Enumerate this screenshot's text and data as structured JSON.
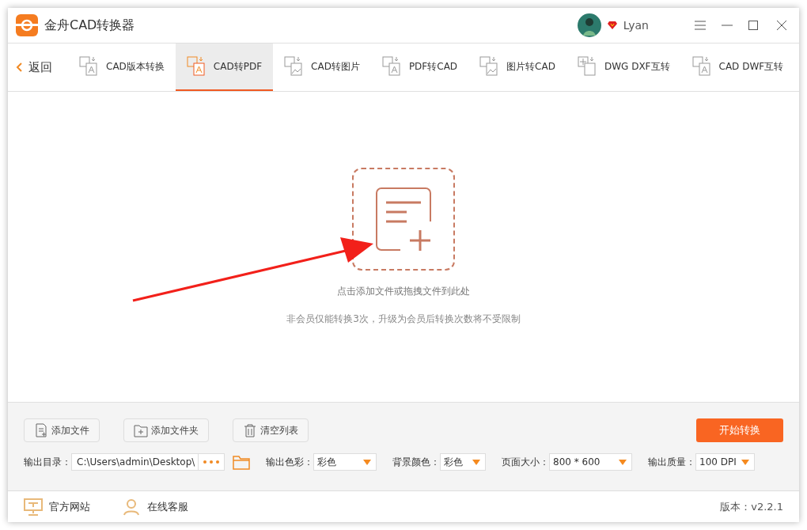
{
  "window": {
    "title": "金舟CAD转换器",
    "user": "Lyan"
  },
  "toolbar": {
    "back": "返回",
    "tabs": [
      {
        "label": "CAD版本转换",
        "selected": false,
        "kind": "a"
      },
      {
        "label": "CAD转PDF",
        "selected": true,
        "kind": "pdf"
      },
      {
        "label": "CAD转图片",
        "selected": false,
        "kind": "img"
      },
      {
        "label": "PDF转CAD",
        "selected": false,
        "kind": "p"
      },
      {
        "label": "图片转CAD",
        "selected": false,
        "kind": "img"
      },
      {
        "label": "DWG DXF互转",
        "selected": false,
        "kind": "grid"
      },
      {
        "label": "CAD DWF互转",
        "selected": false,
        "kind": "d"
      }
    ]
  },
  "dropzone": {
    "hint": "点击添加文件或拖拽文件到此处",
    "note": "非会员仅能转换3次，升级为会员后转换次数将不受限制"
  },
  "actions": [
    {
      "label": "添加文件",
      "kind": "file"
    },
    {
      "label": "添加文件夹",
      "kind": "folder"
    },
    {
      "label": "清空列表",
      "kind": "trash"
    }
  ],
  "start_button": "开始转换",
  "output_dir": {
    "label": "输出目录：",
    "value": "C:\\Users\\admin\\Desktop\\"
  },
  "options": [
    {
      "label": "输出色彩：",
      "value": "彩色"
    },
    {
      "label": "背景颜色：",
      "value": "彩色"
    },
    {
      "label": "页面大小：",
      "value": "800 * 600"
    },
    {
      "label": "输出质量：",
      "value": "100 DPI"
    }
  ],
  "footer": {
    "links": [
      {
        "label": "官方网站",
        "kind": "monitor"
      },
      {
        "label": "在线客服",
        "kind": "user"
      }
    ],
    "version": "版本：v2.2.1"
  }
}
